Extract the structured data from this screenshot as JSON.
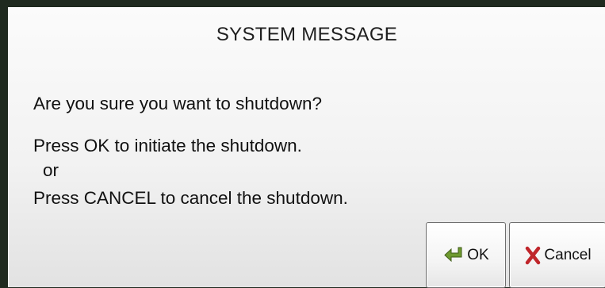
{
  "dialog": {
    "title": "SYSTEM MESSAGE",
    "question": "Are you sure you want to shutdown?",
    "ok_instruction": "Press OK to initiate the shutdown.",
    "or_text": "or",
    "cancel_instruction": "Press CANCEL to cancel the shutdown."
  },
  "buttons": {
    "ok": {
      "label": "OK",
      "icon": "enter-arrow-icon",
      "icon_color": "#6e9a2f"
    },
    "cancel": {
      "label": "Cancel",
      "icon": "x-icon",
      "icon_color": "#c0262b"
    }
  }
}
